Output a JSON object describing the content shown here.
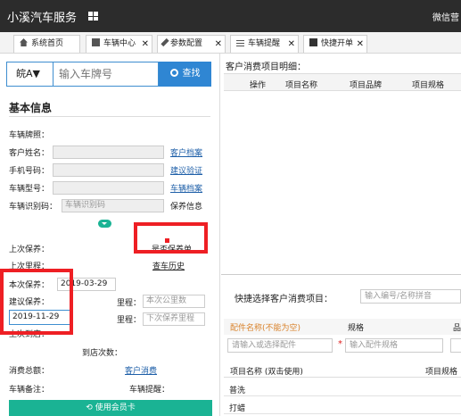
{
  "app": {
    "title": "小溪汽车服务",
    "right_text": "微信营"
  },
  "tabs": [
    {
      "label": "系统首页",
      "closable": false
    },
    {
      "label": "车辆中心",
      "closable": true
    },
    {
      "label": "参数配置",
      "closable": true
    },
    {
      "label": "车辆提醒",
      "closable": true
    },
    {
      "label": "快捷开单",
      "closable": true
    }
  ],
  "search": {
    "plate_prefix": "皖A▼",
    "placeholder": "输入车牌号",
    "button": "查找"
  },
  "basic": {
    "title": "基本信息",
    "plate_label": "车辆牌照：",
    "customer_label": "客户姓名：",
    "customer_link": "客户档案",
    "phone_label": "手机号码：",
    "phone_link": "建议验证",
    "model_label": "车辆型号：",
    "model_link": "车辆档案",
    "vin_label": "车辆识别码：",
    "vin_placeholder": "车辆识别码",
    "vin_link": "保养信息",
    "last_maint_label": "上次保养：",
    "maint_badge": "是否保养单",
    "last_mileage_label": "上次里程：",
    "history_link": "查车历史",
    "this_maint_label": "本次保养：",
    "this_maint_value": "2019-03-29",
    "suggest_maint_label": "建议保养：",
    "suggest_maint_value": "2019-11-29",
    "mileage_label": "里程：",
    "mileage_placeholder": "本次公里数",
    "mileage2_label": "里程：",
    "mileage2_placeholder": "下次保养里程",
    "last_visit_label": "上次到店：",
    "visit_count_label": "到店次数：",
    "total_spend_label": "消费总额：",
    "spend_link": "客户消费",
    "vehicle_note_label": "车辆备注：",
    "vehicle_remind_label": "车辆提醒：",
    "member_button": "使用会员卡"
  },
  "consume": {
    "title": "客户消费项目明细：",
    "headers": [
      "操作",
      "项目名称",
      "项目品牌",
      "项目规格"
    ]
  },
  "quick": {
    "title": "快捷选择客户消费项目：",
    "search_placeholder": "输入编号/名称拼音",
    "part_name_label": "配件名称(不能为空)",
    "spec_label": "规格",
    "extra_label": "品",
    "part_placeholder": "请输入或选择配件",
    "spec_placeholder": "输入配件规格",
    "star": "*",
    "list_headers": [
      "项目名称 (双击使用)",
      "项目规格"
    ],
    "items": [
      "普洗",
      "打蜡"
    ]
  }
}
